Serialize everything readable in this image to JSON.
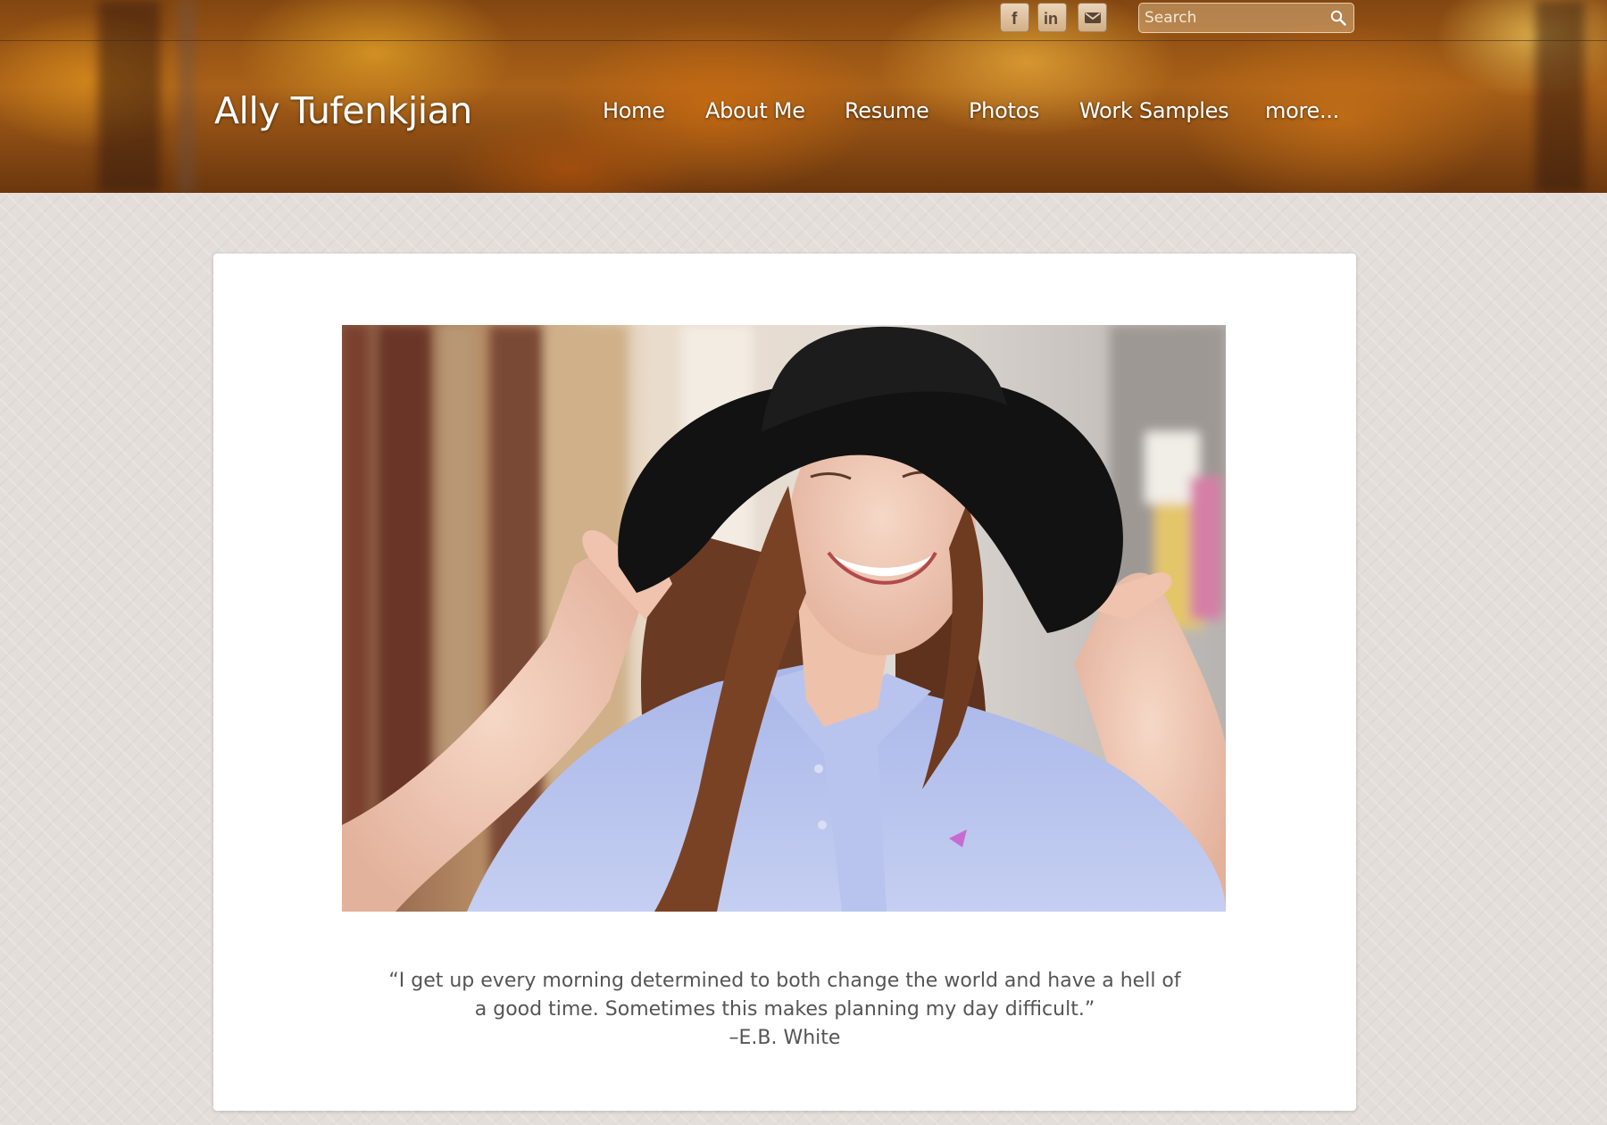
{
  "header": {
    "site_title": "Ally Tufenkjian",
    "nav": [
      "Home",
      "About Me",
      "Resume",
      "Photos",
      "Work Samples",
      "more..."
    ],
    "social": [
      {
        "name": "facebook-icon",
        "glyph": "f"
      },
      {
        "name": "linkedin-icon",
        "glyph": "in"
      },
      {
        "name": "email-icon",
        "glyph": "mail"
      }
    ],
    "search_placeholder": "Search"
  },
  "main": {
    "quote_line1": "“I get up every morning determined to both change  the world and have a hell of",
    "quote_line2": "a good time.  Sometimes this makes planning my day difficult.”",
    "quote_author": "–E.B. White"
  },
  "colors": {
    "banner_accent": "#d98a22",
    "page_background": "#e4dedb",
    "text_gray": "#555555"
  }
}
